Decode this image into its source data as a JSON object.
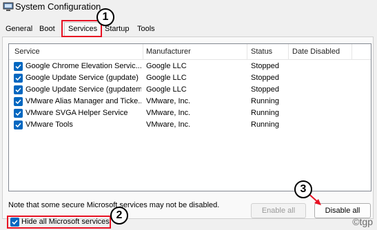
{
  "window": {
    "title": "System Configuration"
  },
  "tabs": [
    "General",
    "Boot",
    "Services",
    "Startup",
    "Tools"
  ],
  "active_tab": "Services",
  "columns": [
    "Service",
    "Manufacturer",
    "Status",
    "Date Disabled"
  ],
  "services": [
    {
      "name": "Google Chrome Elevation Servic...",
      "manufacturer": "Google LLC",
      "status": "Stopped",
      "date_disabled": "",
      "checked": true
    },
    {
      "name": "Google Update Service (gupdate)",
      "manufacturer": "Google LLC",
      "status": "Stopped",
      "date_disabled": "",
      "checked": true
    },
    {
      "name": "Google Update Service (gupdatem)",
      "manufacturer": "Google LLC",
      "status": "Stopped",
      "date_disabled": "",
      "checked": true
    },
    {
      "name": "VMware Alias Manager and Ticke...",
      "manufacturer": "VMware, Inc.",
      "status": "Running",
      "date_disabled": "",
      "checked": true
    },
    {
      "name": "VMware SVGA Helper Service",
      "manufacturer": "VMware, Inc.",
      "status": "Running",
      "date_disabled": "",
      "checked": true
    },
    {
      "name": "VMware Tools",
      "manufacturer": "VMware, Inc.",
      "status": "Running",
      "date_disabled": "",
      "checked": true
    }
  ],
  "note": "Note that some secure Microsoft services may not be disabled.",
  "buttons": {
    "enable_all": "Enable all",
    "disable_all": "Disable all"
  },
  "hide_ms": {
    "label": "Hide all Microsoft services",
    "checked": true
  },
  "annotations": [
    "1",
    "2",
    "3"
  ],
  "watermark": "©tgp",
  "colors": {
    "accent": "#0067c0",
    "highlight": "#e81123"
  }
}
